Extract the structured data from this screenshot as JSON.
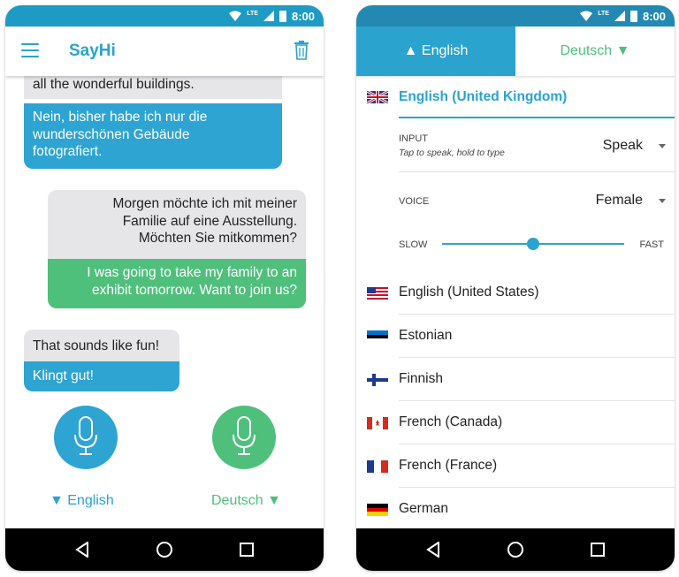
{
  "status_bar": {
    "time": "8:00",
    "network": "LTE"
  },
  "left_screen": {
    "app_title": "SayHi",
    "messages": [
      {
        "type": "grey",
        "text": "all the wonderful buildings."
      },
      {
        "type": "blue",
        "lines": [
          "Nein, bisher habe ich nur die",
          "wunderschönen Gebäude",
          "fotografiert."
        ]
      },
      {
        "type": "grey",
        "lines": [
          "Morgen möchte ich mit meiner",
          "Familie auf eine Ausstellung.",
          "Möchten Sie mitkommen?"
        ]
      },
      {
        "type": "green",
        "lines": [
          "I was going to take my family to an",
          "exhibit tomorrow. Want to join us?"
        ]
      },
      {
        "type": "grey",
        "text": "That sounds like fun!"
      },
      {
        "type": "blue",
        "text": "Klingt gut!"
      }
    ],
    "left_language": "▼ English",
    "right_language": "Deutsch ▼"
  },
  "right_screen": {
    "tab_source": "▲ English",
    "tab_target": "Deutsch ▼",
    "selected_language": "English (United Kingdom)",
    "input_label": "INPUT",
    "input_hint": "Tap to speak, hold to type",
    "input_value": "Speak",
    "voice_label": "VOICE",
    "voice_value": "Female",
    "speed_slow": "SLOW",
    "speed_fast": "FAST",
    "speed_level": 0.5,
    "languages": [
      "English (United States)",
      "Estonian",
      "Finnish",
      "French (Canada)",
      "French (France)",
      "German"
    ]
  },
  "colors": {
    "blue": "#2aa3cf",
    "green": "#4fc07c",
    "status_bar": "#1e9bc4"
  }
}
